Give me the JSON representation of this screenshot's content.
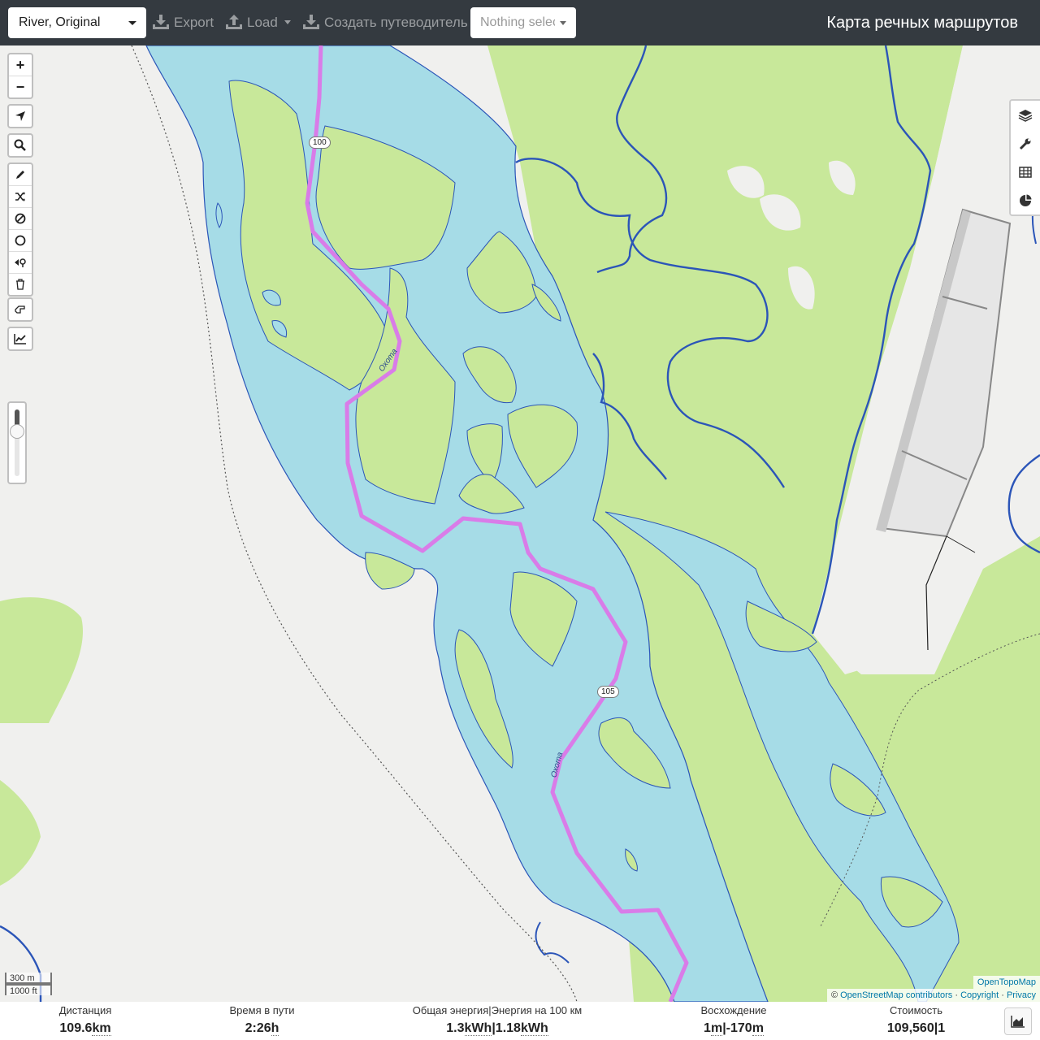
{
  "navbar": {
    "profile_select": "River, Original",
    "export_label": "Export",
    "load_label": "Load",
    "guide_label": "Создать путеводитель",
    "track_select_placeholder": "Nothing selected",
    "app_title": "Карта речных маршрутов"
  },
  "map": {
    "route_color": "#d97ce8",
    "water_color": "#a6dce7",
    "forest_color": "#c8e89a",
    "km_markers": [
      "100",
      "105"
    ],
    "river_labels": [
      "Охота",
      "Охота"
    ],
    "scale": {
      "metric": "300 m",
      "imperial": "1000 ft"
    },
    "attribution": {
      "tile_provider": "OpenTopoMap",
      "copyright_prefix": "©",
      "osm": "OpenStreetMap contributors",
      "copyright": "Copyright",
      "privacy": "Privacy"
    },
    "left_controls": [
      "zoom-in-icon",
      "zoom-out-icon",
      "locate-icon",
      "search-icon",
      "draw-icon",
      "shuffle-icon",
      "no-go-icon",
      "circle-icon",
      "poi-icon",
      "delete-icon",
      "reverse-icon",
      "elevation-chart-icon"
    ],
    "right_controls": [
      "layers-icon",
      "wrench-icon",
      "table-icon",
      "pie-chart-icon"
    ]
  },
  "stats": {
    "distance_label": "Дистанция",
    "distance_value": "109.6",
    "distance_unit": "km",
    "time_label": "Время в пути",
    "time_value": "2:26",
    "time_unit": "h",
    "energy_label": "Общая энергия|Энергия на 100 км",
    "energy_total": "1.3",
    "energy_total_unit": "kWh",
    "energy_sep": "|",
    "energy_per100": "1.18",
    "energy_per100_unit": "kWh",
    "ascent_label": "Восхождение",
    "ascent_value": "1",
    "ascent_unit": "m",
    "ascent_sep": "|",
    "descent_value": "-170",
    "descent_unit": "m",
    "cost_label": "Стоимость",
    "cost_value": "109,560",
    "cost_sep": "|",
    "cost_extra": "1"
  }
}
